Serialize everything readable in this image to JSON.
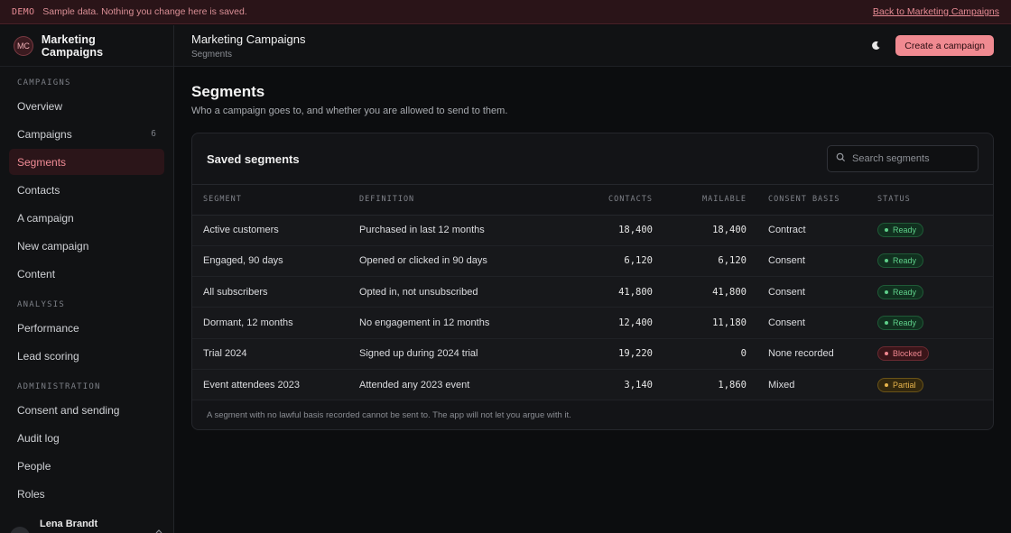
{
  "banner": {
    "tag": "DEMO",
    "message": "Sample data. Nothing you change here is saved.",
    "link": "Back to Marketing Campaigns"
  },
  "sidebar": {
    "logo": "MC",
    "app_name": "Marketing Campaigns",
    "sections": [
      {
        "heading": "CAMPAIGNS",
        "items": [
          {
            "label": "Overview"
          },
          {
            "label": "Campaigns",
            "count": "6"
          },
          {
            "label": "Segments",
            "active": true
          },
          {
            "label": "Contacts"
          },
          {
            "label": "A campaign"
          },
          {
            "label": "New campaign"
          },
          {
            "label": "Content"
          }
        ]
      },
      {
        "heading": "ANALYSIS",
        "items": [
          {
            "label": "Performance"
          },
          {
            "label": "Lead scoring"
          }
        ]
      },
      {
        "heading": "ADMINISTRATION",
        "items": [
          {
            "label": "Consent and sending"
          },
          {
            "label": "Audit log"
          },
          {
            "label": "People"
          },
          {
            "label": "Roles"
          }
        ]
      }
    ],
    "user": {
      "initials": "LB",
      "name": "Lena Brandt"
    }
  },
  "topbar": {
    "title": "Marketing Campaigns",
    "breadcrumb": "Segments",
    "theme_icon": "moon-icon",
    "create_label": "Create a campaign"
  },
  "page": {
    "title": "Segments",
    "subtitle": "Who a campaign goes to, and whether you are allowed to send to them."
  },
  "card": {
    "title": "Saved segments",
    "search_placeholder": "Search segments",
    "columns": [
      "SEGMENT",
      "DEFINITION",
      "CONTACTS",
      "MAILABLE",
      "CONSENT BASIS",
      "STATUS"
    ],
    "rows": [
      {
        "segment": "Active customers",
        "definition": "Purchased in last 12 months",
        "contacts": "18,400",
        "mailable": "18,400",
        "consent": "Contract",
        "status": "Ready",
        "status_kind": "ready"
      },
      {
        "segment": "Engaged, 90 days",
        "definition": "Opened or clicked in 90 days",
        "contacts": "6,120",
        "mailable": "6,120",
        "consent": "Consent",
        "status": "Ready",
        "status_kind": "ready"
      },
      {
        "segment": "All subscribers",
        "definition": "Opted in, not unsubscribed",
        "contacts": "41,800",
        "mailable": "41,800",
        "consent": "Consent",
        "status": "Ready",
        "status_kind": "ready"
      },
      {
        "segment": "Dormant, 12 months",
        "definition": "No engagement in 12 months",
        "contacts": "12,400",
        "mailable": "11,180",
        "consent": "Consent",
        "status": "Ready",
        "status_kind": "ready"
      },
      {
        "segment": "Trial 2024",
        "definition": "Signed up during 2024 trial",
        "contacts": "19,220",
        "mailable": "0",
        "consent": "None recorded",
        "status": "Blocked",
        "status_kind": "blocked"
      },
      {
        "segment": "Event attendees 2023",
        "definition": "Attended any 2023 event",
        "contacts": "3,140",
        "mailable": "1,860",
        "consent": "Mixed",
        "status": "Partial",
        "status_kind": "partial"
      }
    ],
    "footnote": "A segment with no lawful basis recorded cannot be sent to. The app will not let you argue with it."
  }
}
